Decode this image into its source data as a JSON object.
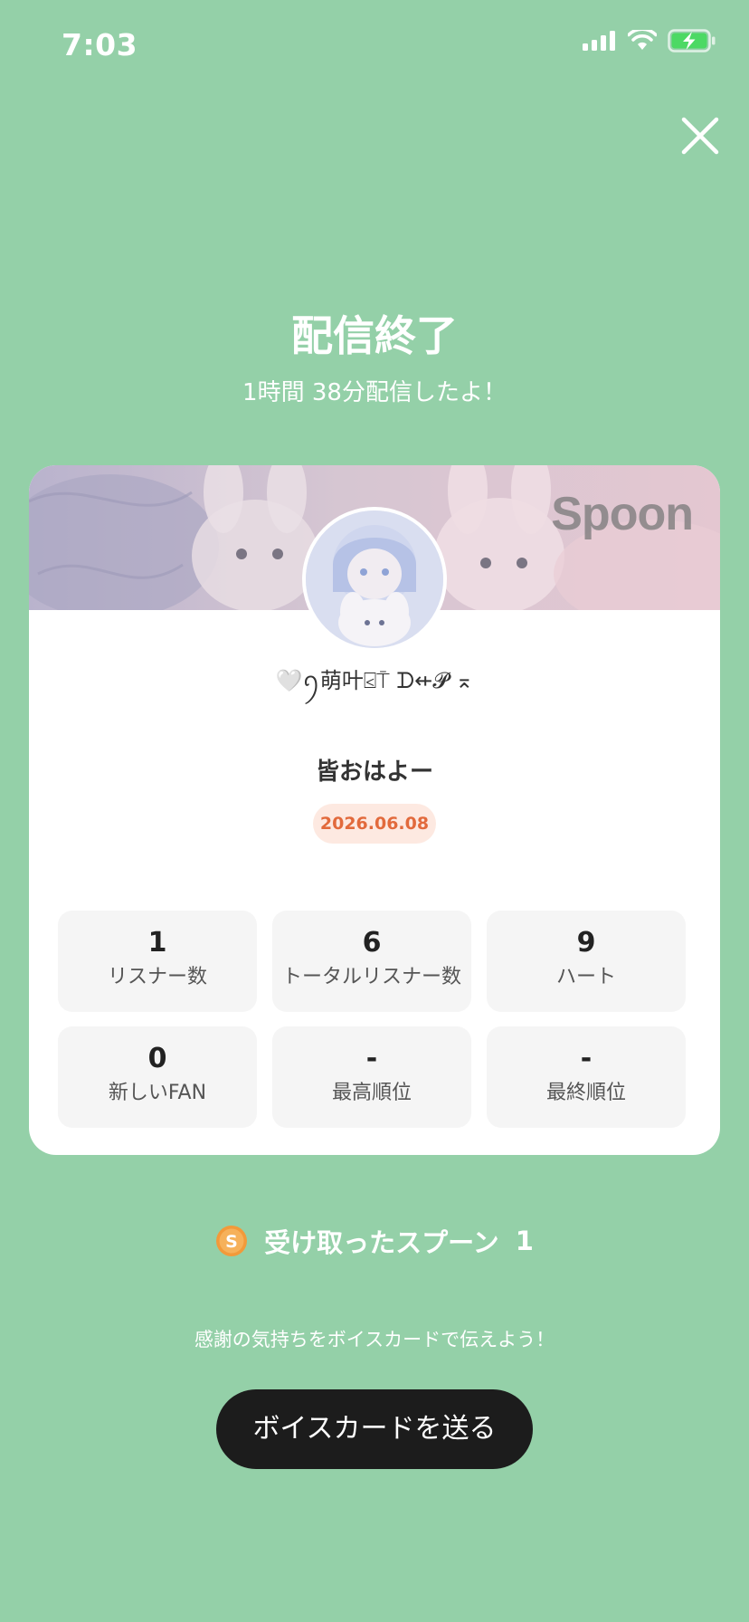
{
  "status_bar": {
    "time": "7:03",
    "icons": [
      "signal-icon",
      "wifi-icon",
      "battery-charging-icon"
    ],
    "battery_color": "#4cd964"
  },
  "header": {
    "close_icon": "close-icon",
    "title": "配信終了",
    "subtitle": "1時間 38分配信したよ！"
  },
  "card": {
    "banner_brand": "Spoon",
    "nickname": "🤍ꪆ萌叶⍃⍑ ᗪ⇷𝓟 ⌅",
    "room_title": "皆おはよー",
    "date": "2026.06.08",
    "stats": [
      {
        "value": "1",
        "label": "リスナー数"
      },
      {
        "value": "6",
        "label": "トータルリスナー数"
      },
      {
        "value": "9",
        "label": "ハート"
      },
      {
        "value": "0",
        "label": "新しいFAN"
      },
      {
        "value": "-",
        "label": "最高順位"
      },
      {
        "value": "-",
        "label": "最終順位"
      }
    ]
  },
  "spoons": {
    "icon": "spoon-coin-icon",
    "coin_letter": "S",
    "label": "受け取ったスプーン",
    "count": "1"
  },
  "thanks_text": "感謝の気持ちをボイスカードで伝えよう！",
  "voice_card_button": "ボイスカードを送る",
  "colors": {
    "background": "#94d0a8",
    "button": "#1c1c1c",
    "date_badge_bg": "#fde9e1",
    "date_badge_text": "#e26a3c",
    "coin": "#f29a3a"
  }
}
